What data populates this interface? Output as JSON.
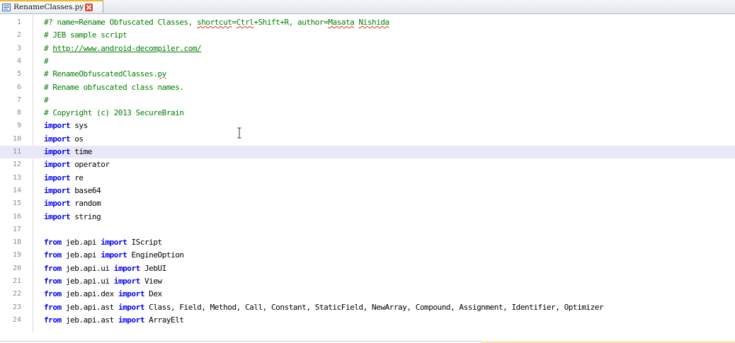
{
  "tab": {
    "label": "RenameClasses.py",
    "icon": "python-file-icon"
  },
  "editor": {
    "current_line": 11,
    "lines": [
      {
        "num": "1",
        "kind": "comment",
        "text": "#? name=Rename Obfuscated Classes, shortcut=Ctrl+Shift+R, author=Masata Nishida"
      },
      {
        "num": "2",
        "kind": "comment",
        "text": "# JEB sample script"
      },
      {
        "num": "3",
        "kind": "comment-link",
        "prefix": "# ",
        "link": "http://www.android-decompiler.com/"
      },
      {
        "num": "4",
        "kind": "comment",
        "text": "#"
      },
      {
        "num": "5",
        "kind": "comment",
        "text": "# RenameObfuscatedClasses.py"
      },
      {
        "num": "6",
        "kind": "comment",
        "text": "# Rename obfuscated class names."
      },
      {
        "num": "7",
        "kind": "comment",
        "text": "#"
      },
      {
        "num": "8",
        "kind": "comment",
        "text": "# Copyright (c) 2013 SecureBrain"
      },
      {
        "num": "9",
        "kind": "import",
        "kw": "import",
        "rest": " sys"
      },
      {
        "num": "10",
        "kind": "import",
        "kw": "import",
        "rest": " os"
      },
      {
        "num": "11",
        "kind": "import",
        "kw": "import",
        "rest": " time"
      },
      {
        "num": "12",
        "kind": "import",
        "kw": "import",
        "rest": " operator"
      },
      {
        "num": "13",
        "kind": "import",
        "kw": "import",
        "rest": " re"
      },
      {
        "num": "14",
        "kind": "import",
        "kw": "import",
        "rest": " base64"
      },
      {
        "num": "15",
        "kind": "import",
        "kw": "import",
        "rest": " random"
      },
      {
        "num": "16",
        "kind": "import",
        "kw": "import",
        "rest": " string"
      },
      {
        "num": "17",
        "kind": "blank",
        "text": ""
      },
      {
        "num": "18",
        "kind": "from",
        "kw1": "from",
        "mod": " jeb.api ",
        "kw2": "import",
        "rest": " IScript"
      },
      {
        "num": "19",
        "kind": "from",
        "kw1": "from",
        "mod": " jeb.api ",
        "kw2": "import",
        "rest": " EngineOption"
      },
      {
        "num": "20",
        "kind": "from",
        "kw1": "from",
        "mod": " jeb.api.ui ",
        "kw2": "import",
        "rest": " JebUI"
      },
      {
        "num": "21",
        "kind": "from",
        "kw1": "from",
        "mod": " jeb.api.ui ",
        "kw2": "import",
        "rest": " View"
      },
      {
        "num": "22",
        "kind": "from",
        "kw1": "from",
        "mod": " jeb.api.dex ",
        "kw2": "import",
        "rest": " Dex"
      },
      {
        "num": "23",
        "kind": "from",
        "kw1": "from",
        "mod": " jeb.api.ast ",
        "kw2": "import",
        "rest": " Class, Field, Method, Call, Constant, StaticField, NewArray, Compound, Assignment, Identifier, Optimizer"
      },
      {
        "num": "24",
        "kind": "from",
        "kw1": "from",
        "mod": " jeb.api.ast ",
        "kw2": "import",
        "rest": " ArrayElt"
      }
    ]
  },
  "colors": {
    "comment": "#008000",
    "keyword": "#0000ff",
    "current_line_bg": "#e8e8f8",
    "line_number": "#8c8c8c",
    "tab_accent": "#f7b32b"
  }
}
